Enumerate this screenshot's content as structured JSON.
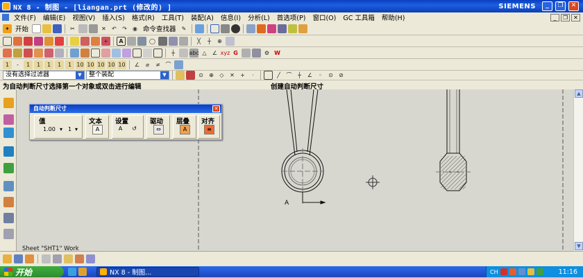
{
  "window": {
    "title": "NX 8 - 制图 - [liangan.prt  (修改的) ]",
    "brand": "SIEMENS",
    "controls": [
      "_",
      "❐",
      "✕"
    ]
  },
  "menu": {
    "items": [
      "文件(F)",
      "编辑(E)",
      "视图(V)",
      "插入(S)",
      "格式(R)",
      "工具(T)",
      "装配(A)",
      "信息(I)",
      "分析(L)",
      "首选项(P)",
      "窗口(O)",
      "GC 工具箱",
      "帮助(H)"
    ],
    "mdi_controls": [
      "_",
      "❐",
      "✕"
    ]
  },
  "toolbar": {
    "start_label": "开始",
    "command_finder_label": "命令查找器",
    "selection_filter": "没有选择过滤器",
    "assembly_scope": "整个装配"
  },
  "cue": {
    "left": "为自动判断尺寸选择第一个对象或双击进行编辑",
    "center": "创建自动判断尺寸"
  },
  "dialog": {
    "title": "自动判断尺寸",
    "close": "✕",
    "groups": {
      "value": {
        "label": "值",
        "precision": "1.00",
        "tolerance": "1"
      },
      "text": {
        "label": "文本"
      },
      "settings": {
        "label": "设置"
      },
      "driving": {
        "label": "驱动"
      },
      "stack": {
        "label": "层叠"
      },
      "align": {
        "label": "对齐"
      }
    }
  },
  "drawing": {
    "section_label": "A",
    "sheet_label": "Sheet \"SHT1\" Work"
  },
  "taskbar": {
    "start_label": "开始",
    "task_item": "NX 8 - 制图...",
    "clock": "11:16",
    "tray_text": "CH"
  },
  "colors": {
    "title_blue": "#0a3fbf",
    "canvas": "#d8d7cf",
    "panel": "#ece9d8"
  }
}
